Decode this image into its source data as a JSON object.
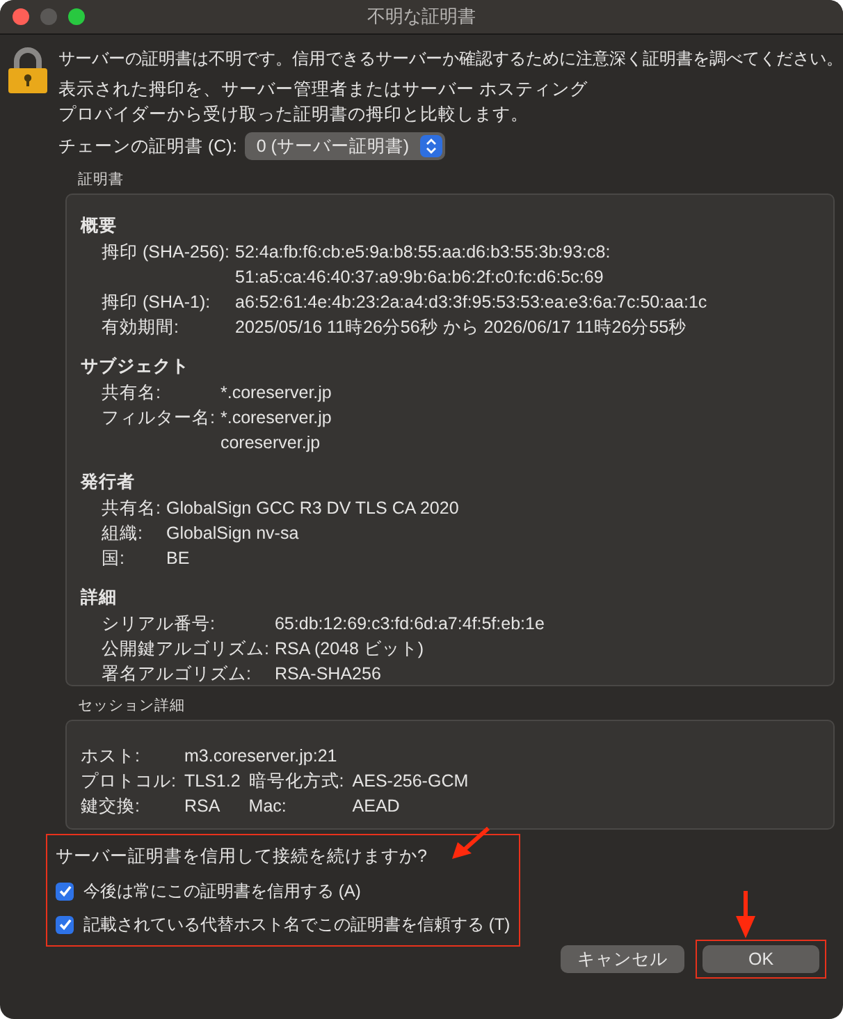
{
  "window": {
    "title": "不明な証明書"
  },
  "message": "サーバーの証明書は不明です。信用できるサーバーか確認するために注意深く証明書を調べてください。",
  "instructions": [
    "表示された拇印を、サーバー管理者またはサーバー ホスティング",
    "プロバイダーから受け取った証明書の拇印と比較します。"
  ],
  "chain": {
    "label": "チェーンの証明書 (C):",
    "value": "0 (サーバー証明書)"
  },
  "certificate": {
    "title": "証明書",
    "sections": [
      {
        "heading": "概要",
        "rows": [
          {
            "label": "拇印 (SHA-256):",
            "values": [
              "52:4a:fb:f6:cb:e5:9a:b8:55:aa:d6:b3:55:3b:93:c8:",
              "51:a5:ca:46:40:37:a9:9b:6a:b6:2f:c0:fc:d6:5c:69"
            ]
          },
          {
            "label": "拇印 (SHA-1):",
            "values": [
              "a6:52:61:4e:4b:23:2a:a4:d3:3f:95:53:53:ea:e3:6a:7c:50:aa:1c"
            ]
          },
          {
            "label": "有効期間:",
            "values": [
              "2025/05/16 11時26分56秒 から 2026/06/17 11時26分55秒"
            ]
          }
        ]
      },
      {
        "heading": "サブジェクト",
        "rows": [
          {
            "label": "共有名:",
            "values": [
              "*.coreserver.jp"
            ]
          },
          {
            "label": "フィルター名:",
            "values": [
              "*.coreserver.jp",
              "coreserver.jp"
            ]
          }
        ]
      },
      {
        "heading": "発行者",
        "rows": [
          {
            "label": "共有名:",
            "values": [
              "GlobalSign GCC R3 DV TLS CA 2020"
            ]
          },
          {
            "label": "組織:",
            "values": [
              "GlobalSign nv-sa"
            ]
          },
          {
            "label": "国:",
            "values": [
              "BE"
            ]
          }
        ]
      },
      {
        "heading": "詳細",
        "rows": [
          {
            "label": "シリアル番号:",
            "values": [
              "65:db:12:69:c3:fd:6d:a7:4f:5f:eb:1e"
            ]
          },
          {
            "label": "公開鍵アルゴリズム:",
            "values": [
              "RSA (2048 ビット)"
            ]
          },
          {
            "label": "署名アルゴリズム:",
            "values": [
              "RSA-SHA256"
            ]
          }
        ]
      }
    ]
  },
  "session": {
    "title": "セッション詳細",
    "rows": [
      {
        "fields": [
          {
            "label": "ホスト:",
            "value": "m3.coreserver.jp:21"
          }
        ]
      },
      {
        "fields": [
          {
            "label": "プロトコル:",
            "value": "TLS1.2"
          },
          {
            "label": "暗号化方式:",
            "value": "AES-256-GCM"
          }
        ]
      },
      {
        "fields": [
          {
            "label": "鍵交換:",
            "value": "RSA"
          },
          {
            "label": "Mac:",
            "value": "AEAD"
          }
        ]
      }
    ]
  },
  "question": "サーバー証明書を信用して接続を続けますか?",
  "options": [
    {
      "label": "今後は常にこの証明書を信用する (A)",
      "checked": true
    },
    {
      "label": "記載されている代替ホスト名でこの証明書を信頼する (T)",
      "checked": true
    }
  ],
  "buttons": [
    {
      "label": "キャンセル",
      "kind": "cancel"
    },
    {
      "label": "OK",
      "kind": "default"
    }
  ]
}
